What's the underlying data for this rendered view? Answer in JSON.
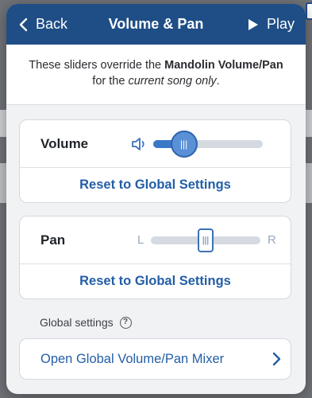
{
  "header": {
    "back_label": "Back",
    "title": "Volume & Pan",
    "play_label": "Play"
  },
  "info": {
    "prefix": "These sliders override the ",
    "instrument": "Mandolin Volume/Pan",
    "middle": " for the ",
    "scope": "current song only",
    "suffix": "."
  },
  "volume": {
    "label": "Volume",
    "level": 0.28,
    "reset_label": "Reset to Global Settings"
  },
  "pan": {
    "label": "Pan",
    "left_label": "L",
    "right_label": "R",
    "position": 0.5,
    "reset_label": "Reset to Global Settings"
  },
  "global": {
    "section_label": "Global settings",
    "mixer_label": "Open Global Volume/Pan Mixer"
  },
  "colors": {
    "nav": "#1f4e86",
    "accent": "#235ea6",
    "slider_fill": "#3b79c8"
  },
  "icons": [
    "chevron-left-icon",
    "play-icon",
    "speaker-icon",
    "help-icon",
    "chevron-right-icon"
  ]
}
